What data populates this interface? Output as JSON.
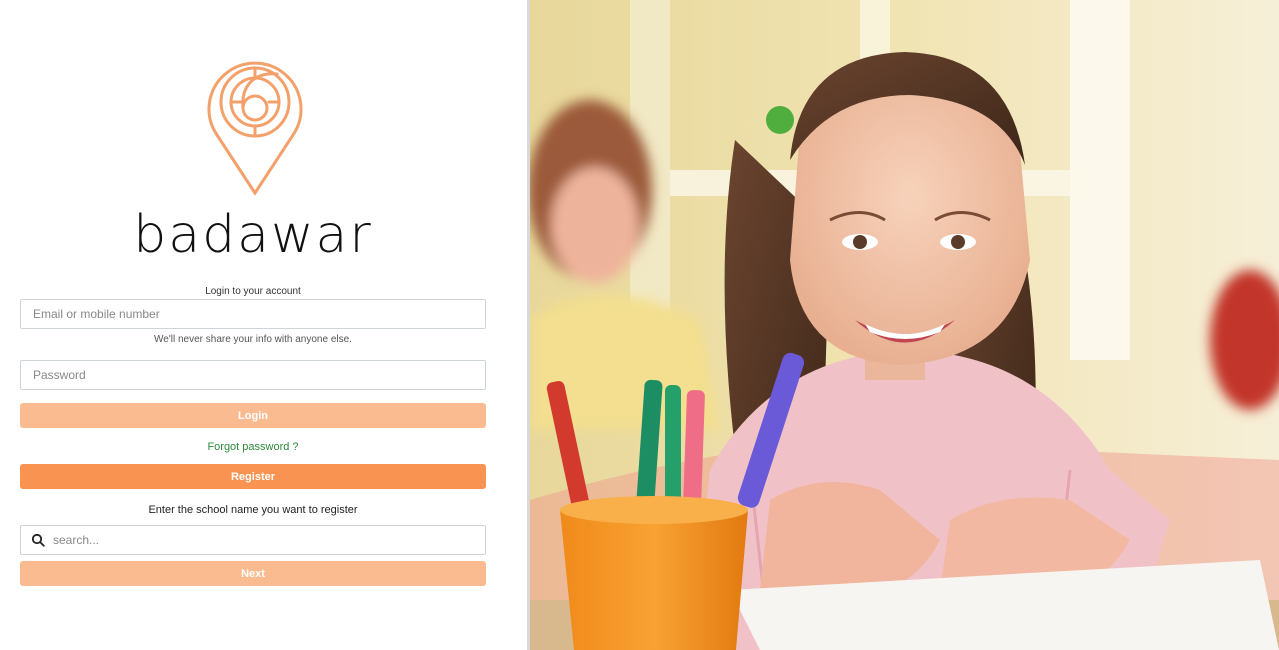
{
  "brand": {
    "name": "badawar",
    "accent": "#f4a06b"
  },
  "login": {
    "title": "Login to your account",
    "email_placeholder": "Email or mobile number",
    "hint": "We'll never share your info with anyone else.",
    "password_placeholder": "Password",
    "login_label": "Login",
    "forgot_label": "Forgot password ?",
    "register_label": "Register"
  },
  "school": {
    "label": "Enter the school name you want to register",
    "search_placeholder": "search...",
    "next_label": "Next"
  },
  "icons": {
    "search": "search-icon",
    "logo": "badawar-logo-icon"
  },
  "colors": {
    "button_light": "#fbbb90",
    "button_strong": "#f99352",
    "link": "#2e8b3c"
  }
}
